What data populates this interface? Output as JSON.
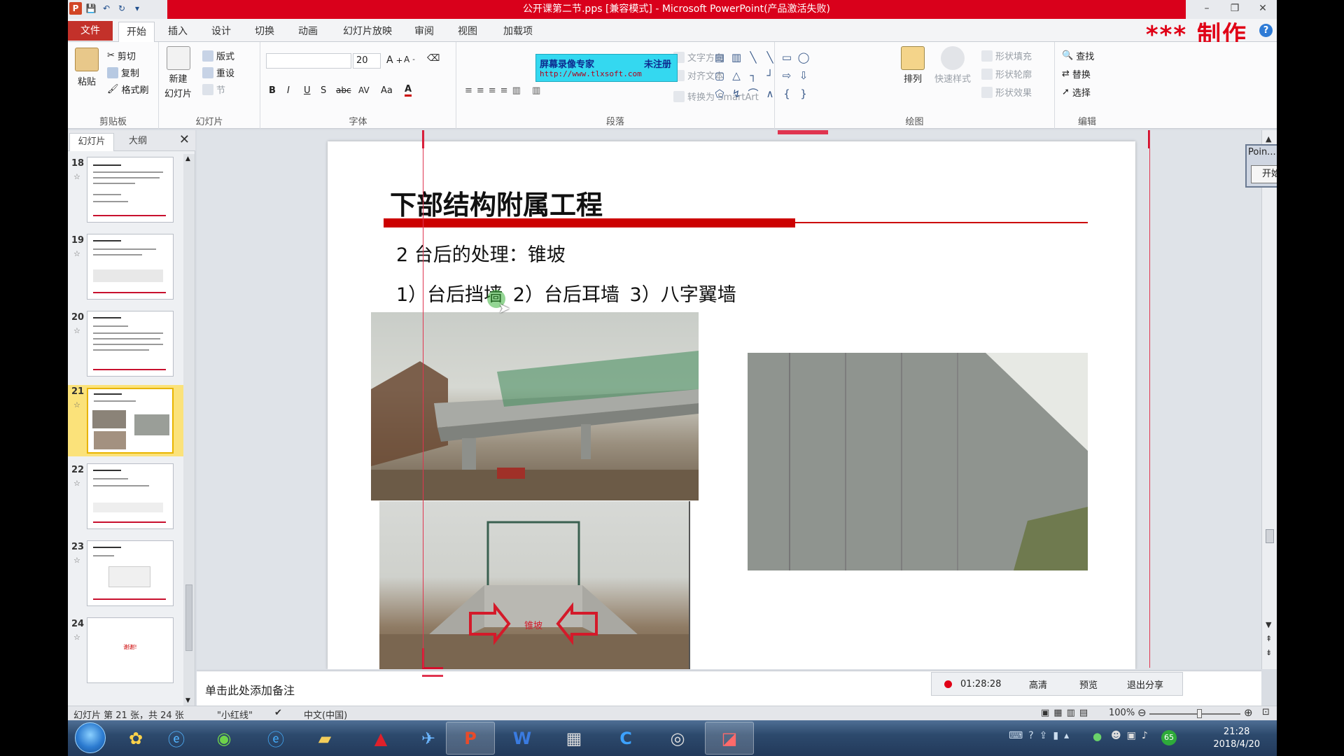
{
  "window": {
    "title": "公开课第二节.pps [兼容模式] - Microsoft PowerPoint(产品激活失败)",
    "brand": "*** 制作"
  },
  "menu_tabs": [
    "文件",
    "开始",
    "插入",
    "设计",
    "切换",
    "动画",
    "幻灯片放映",
    "审阅",
    "视图",
    "加载项"
  ],
  "ribbon": {
    "clipboard": {
      "label": "剪贴板",
      "paste": "粘贴",
      "cut": "剪切",
      "copy": "复制",
      "format_painter": "格式刷"
    },
    "slides": {
      "label": "幻灯片",
      "new_slide": "新建",
      "new_slide2": "幻灯片",
      "layout": "版式",
      "reset": "重设",
      "section": "节"
    },
    "font": {
      "label": "字体",
      "size": "20",
      "bold": "B",
      "italic": "I",
      "underline": "U",
      "shadow": "S",
      "strike": "abc",
      "spacing": "AV",
      "case": "Aa",
      "color": "A"
    },
    "paragraph": {
      "label": "段落",
      "text_direction": "文字方向",
      "align_text": "对齐文本",
      "smartart": "转换为 SmartArt"
    },
    "ad": {
      "line1": "屏幕录像专家",
      "line2": "未注册",
      "url": "http://www.tlxsoft.com"
    },
    "drawing": {
      "label": "绘图",
      "arrange": "排列",
      "quick_styles": "快速样式",
      "fill": "形状填充",
      "outline": "形状轮廓",
      "effects": "形状效果"
    },
    "editing": {
      "label": "编辑",
      "find": "查找",
      "replace": "替换",
      "select": "选择"
    }
  },
  "left_pane": {
    "tab_slides": "幻灯片",
    "tab_outline": "大纲",
    "close": "✕",
    "thumbnails": [
      {
        "num": "18"
      },
      {
        "num": "19"
      },
      {
        "num": "20"
      },
      {
        "num": "21",
        "selected": true
      },
      {
        "num": "22"
      },
      {
        "num": "23"
      },
      {
        "num": "24",
        "text": "谢谢!"
      }
    ]
  },
  "slide": {
    "title": "下部结构附属工程",
    "line1": "2 台后的处理：锥坡",
    "line2": "1）台后挡墙  2）台后耳墙   3）八字翼墙",
    "red_label": "锥坡"
  },
  "pointer_widget": {
    "title": "Poin...",
    "start": "开始"
  },
  "notes": {
    "placeholder": "单击此处添加备注"
  },
  "recorder": {
    "time": "01:28:28",
    "hd": "高清",
    "preview": "预览",
    "exit_share": "退出分享"
  },
  "status_bar": {
    "slide_info": "幻灯片 第 21 张，共 24 张",
    "theme": "\"小红线\"",
    "language": "中文(中国)",
    "zoom": "100%"
  },
  "taskbar": {
    "time": "21:28",
    "date": "2018/4/20",
    "badge": "65"
  }
}
